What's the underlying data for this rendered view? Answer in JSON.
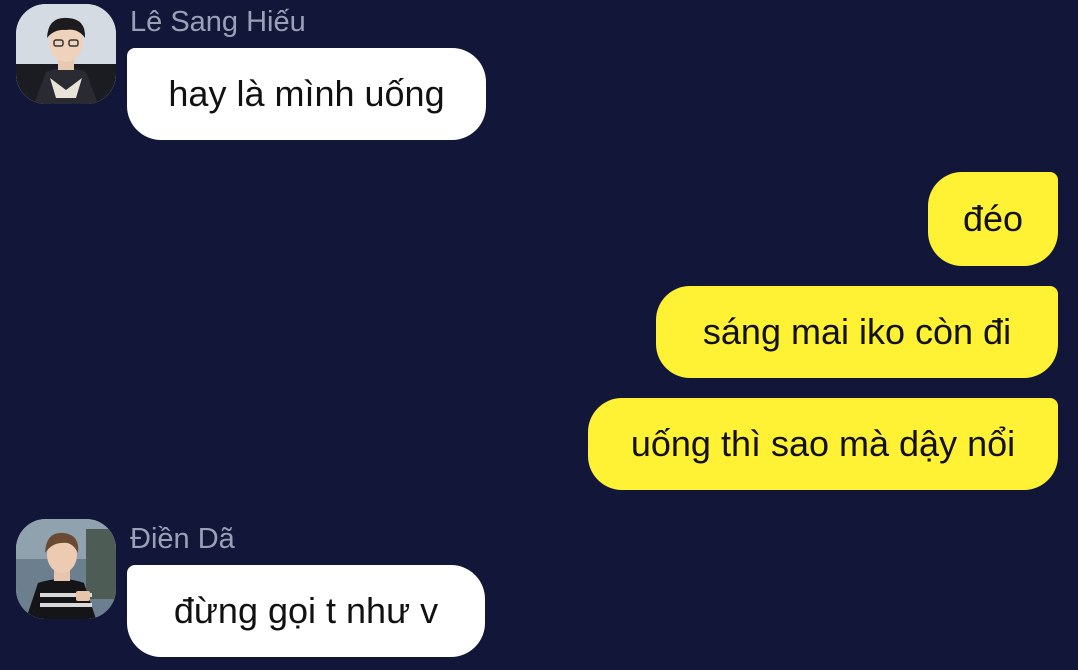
{
  "messages": [
    {
      "sender": "Lê Sang Hiếu",
      "text": "hay là mình uống",
      "avatar_icon": "user-avatar-hieu-icon"
    },
    {
      "text": "đéo"
    },
    {
      "text": "sáng mai iko còn đi"
    },
    {
      "text": "uống thì sao mà dậy nổi"
    },
    {
      "sender": "Điền Dã",
      "text": "đừng gọi t như v",
      "avatar_icon": "user-avatar-da-icon"
    }
  ],
  "colors": {
    "background": "#121638",
    "incoming_bubble": "#ffffff",
    "outgoing_bubble": "#fff133",
    "sender_name": "#9aa0b5",
    "message_text": "#111111"
  }
}
